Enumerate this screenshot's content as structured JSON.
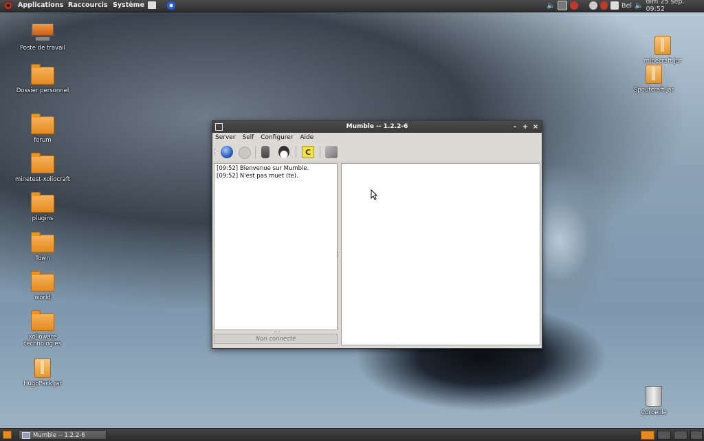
{
  "top_panel": {
    "menus": [
      "Applications",
      "Raccourcis",
      "Système"
    ],
    "keyboard_layout": "Bel",
    "clock": "dim 25 sep. 09:52"
  },
  "desktop_icons_left": [
    {
      "label": "Poste de travail",
      "icon": "computer-icon"
    },
    {
      "label": "Dossier personnel",
      "icon": "home-folder-icon"
    },
    {
      "label": "forum",
      "icon": "folder-icon"
    },
    {
      "label": "minetest-xoliocraft",
      "icon": "folder-icon"
    },
    {
      "label": "plugins",
      "icon": "folder-icon"
    },
    {
      "label": "Town",
      "icon": "folder-icon"
    },
    {
      "label": "world",
      "icon": "folder-icon"
    },
    {
      "label": "xolioware technologies",
      "icon": "folder-icon"
    },
    {
      "label": "HugoPack.jar",
      "icon": "jar-icon"
    }
  ],
  "desktop_icons_right": [
    {
      "label": "minecraft.jar",
      "icon": "jar-icon"
    },
    {
      "label": "Spoutcraft.jar",
      "icon": "jar-icon"
    },
    {
      "label": "Corbeille",
      "icon": "trash-icon"
    }
  ],
  "mumble": {
    "title": "Mumble -- 1.2.2-6",
    "menu": [
      "Server",
      "Self",
      "Configurer",
      "Aide"
    ],
    "log": [
      "[09:52] Bienvenue sur Mumble.",
      "[09:52] N'est pas muet (te)."
    ],
    "status": "Non connecté"
  },
  "taskbar": {
    "window_label": "Mumble -- 1.2.2-6"
  },
  "colors": {
    "panel": "#3a3a3a",
    "folder": "#e48a1f"
  }
}
